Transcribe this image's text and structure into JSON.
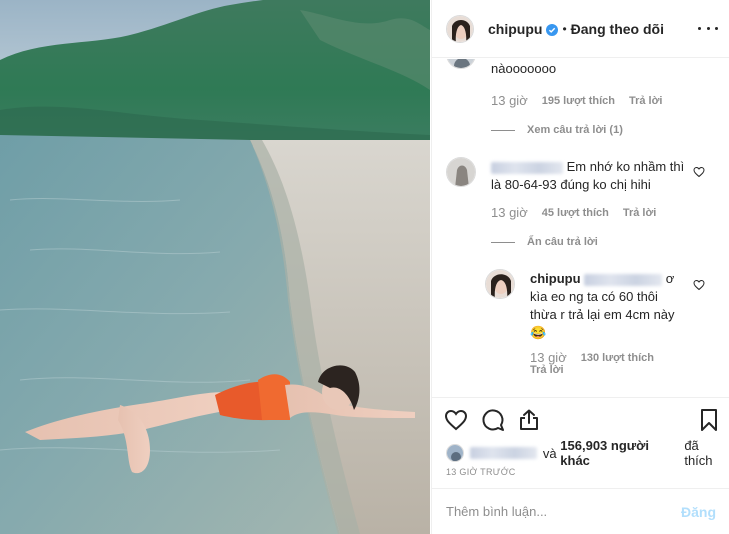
{
  "header": {
    "username": "chipupu",
    "separator": "•",
    "follow_status": "Đang theo dõi"
  },
  "comments": {
    "c1_text_tail": "nàooooooo",
    "c1_time": "13 giờ",
    "c1_likes": "195 lượt thích",
    "c1_reply": "Trả lời",
    "c1_view_replies": "Xem câu trả lời (1)",
    "c2_line1": "Em nhớ ko nhầm thì",
    "c2_line2": "là 80-64-93 đúng ko chị hihi",
    "c2_time": "13 giờ",
    "c2_likes": "45 lượt thích",
    "c2_reply": "Trả lời",
    "c2_hide_replies": "Ẩn câu trả lời",
    "r1_username": "chipupu",
    "r1_tail": "ơ",
    "r1_line2": "kìa eo ng ta có 60 thôi",
    "r1_line3": "thừa r trả lại em 4cm này",
    "r1_emoji": "😂",
    "r1_time": "13 giờ",
    "r1_likes": "130 lượt thích",
    "r1_reply": "Trả lời"
  },
  "actions": {
    "likes_text_and": "và",
    "likes_count": "156,903 người khác",
    "likes_text_suffix": "đã thích",
    "timestamp": "13 GIỜ TRƯỚC"
  },
  "add_comment": {
    "placeholder": "Thêm bình luận...",
    "post_label": "Đăng"
  },
  "colors": {
    "verified_blue": "#3897f0",
    "muted_text": "#8e8e8e",
    "post_button_disabled": "#b2dffc"
  },
  "icons": [
    "verified-badge-icon",
    "more-options-icon",
    "heart-icon",
    "comment-icon",
    "share-icon",
    "bookmark-icon",
    "small-heart-icon"
  ]
}
